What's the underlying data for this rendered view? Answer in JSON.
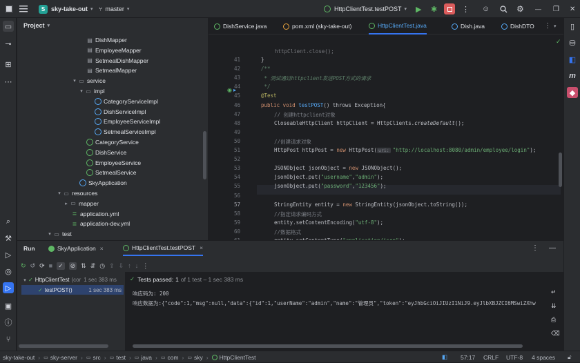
{
  "titlebar": {
    "project_badge": "S",
    "project_name": "sky-take-out",
    "branch": "master",
    "run_config": "HttpClientTest.testPOST"
  },
  "project_panel": {
    "title": "Project",
    "tree": [
      {
        "label": "DishMapper",
        "icon": "mapper-icon"
      },
      {
        "label": "EmployeeMapper",
        "icon": "mapper-icon"
      },
      {
        "label": "SetmealDishMapper",
        "icon": "mapper-icon"
      },
      {
        "label": "SetmealMapper",
        "icon": "mapper-icon"
      },
      {
        "label": "service",
        "icon": "folder-icon"
      },
      {
        "label": "impl",
        "icon": "folder-icon"
      },
      {
        "label": "CategoryServiceImpl",
        "icon": "class-icon"
      },
      {
        "label": "DishServiceImpl",
        "icon": "class-icon"
      },
      {
        "label": "EmployeeServiceImpl",
        "icon": "class-icon"
      },
      {
        "label": "SetmealServiceImpl",
        "icon": "class-icon"
      },
      {
        "label": "CategoryService",
        "icon": "interface-icon"
      },
      {
        "label": "DishService",
        "icon": "interface-icon"
      },
      {
        "label": "EmployeeService",
        "icon": "interface-icon"
      },
      {
        "label": "SetmealService",
        "icon": "interface-icon"
      },
      {
        "label": "SkyApplication",
        "icon": "app-icon"
      },
      {
        "label": "resources",
        "icon": "folder-icon"
      },
      {
        "label": "mapper",
        "icon": "folder-icon"
      },
      {
        "label": "application.yml",
        "icon": "yml-icon"
      },
      {
        "label": "application-dev.yml",
        "icon": "yml-icon"
      },
      {
        "label": "test",
        "icon": "folder-icon"
      }
    ]
  },
  "editor": {
    "tabs": [
      {
        "label": "DishService.java"
      },
      {
        "label": "pom.xml (sky-take-out)"
      },
      {
        "label": "HttpClientTest.java"
      },
      {
        "label": "Dish.java"
      },
      {
        "label": "DishDTO"
      }
    ],
    "line_numbers": [
      "41",
      "42",
      "43",
      "44",
      "45",
      "46",
      "47",
      "48",
      "49",
      "50",
      "51",
      "52",
      "53",
      "54",
      "55",
      "56",
      "57",
      "58",
      "59",
      "60",
      "61",
      "62"
    ],
    "lines": {
      "l40": "httpClient.close();",
      "l41": "}",
      "l42": "/**",
      "l43": " * 测试通过httpclient发送POST方式的请求",
      "l44": " */",
      "l45": "@Test",
      "l46_kw": "public void ",
      "l46_fn": "testPOST",
      "l46_rest": "() throws Exception{",
      "l47": "// 创建httpclient对象",
      "l48a": "CloseableHttpClient httpClient = HttpClients.",
      "l48b": "createDefault",
      "l48c": "();",
      "l50": "//创建请求对象",
      "l51a": "HttpPost httpPost = ",
      "l51kw": "new ",
      "l51b": "HttpPost(",
      "l51hint": "uri:",
      "l51str": "\"http://localhost:8080/admin/employee/login\"",
      "l51c": ");",
      "l53a": "JSONObject jsonObject = ",
      "l53kw": "new ",
      "l53b": "JSONObject();",
      "l54a": "jsonObject.put(",
      "l54s1": "\"username\"",
      "l54s2": "\"admin\"",
      "l54c": ");",
      "l55a": "jsonObject.put(",
      "l55s1": "\"password\"",
      "l55s2": "\"123456\"",
      "l55c": ");",
      "l57a": "StringEntity entity = ",
      "l57kw": "new ",
      "l57b": "StringEntity(jsonObject.toString());",
      "l58": "//指定请求编码方式",
      "l59a": "entity.setContentEncoding(",
      "l59s": "\"utf-8\"",
      "l59c": ");",
      "l60": "//数据格式",
      "l61a": "entity.setContentType(",
      "l61s": "\"application/json\"",
      "l61c": ");",
      "l62": "httpPost.setEntity(entity);"
    },
    "comma": ","
  },
  "run_panel": {
    "tabs": [
      {
        "label": "Run"
      },
      {
        "label": "SkyApplication"
      },
      {
        "label": "HttpClientTest.testPOST"
      }
    ],
    "tree": [
      {
        "label": "HttpClientTest",
        "extra": "(cor",
        "time": "1 sec 383 ms"
      },
      {
        "label": "testPOST()",
        "time": "1 sec 383 ms"
      }
    ],
    "status_passed": "Tests passed:",
    "status_count": "1",
    "status_rest": "of 1 test – 1 sec 383 ms",
    "output": [
      "响应码为: 200",
      "响应数据为:{\"code\":1,\"msg\":null,\"data\":{\"id\":1,\"userName\":\"admin\",\"name\":\"管理员\",\"token\":\"eyJhbGciOiJIUzI1NiJ9.eyJlbXBJZCI6MSwiZXhw"
    ]
  },
  "statusbar": {
    "crumbs": [
      "sky-take-out",
      "sky-server",
      "src",
      "test",
      "java",
      "com",
      "sky",
      "HttpClientTest"
    ],
    "position": "57:17",
    "line_sep": "CRLF",
    "encoding": "UTF-8",
    "indent": "4 spaces"
  },
  "colors": {
    "accent": "#3574f0",
    "pass": "#5fb865",
    "stop": "#db5c5c"
  }
}
